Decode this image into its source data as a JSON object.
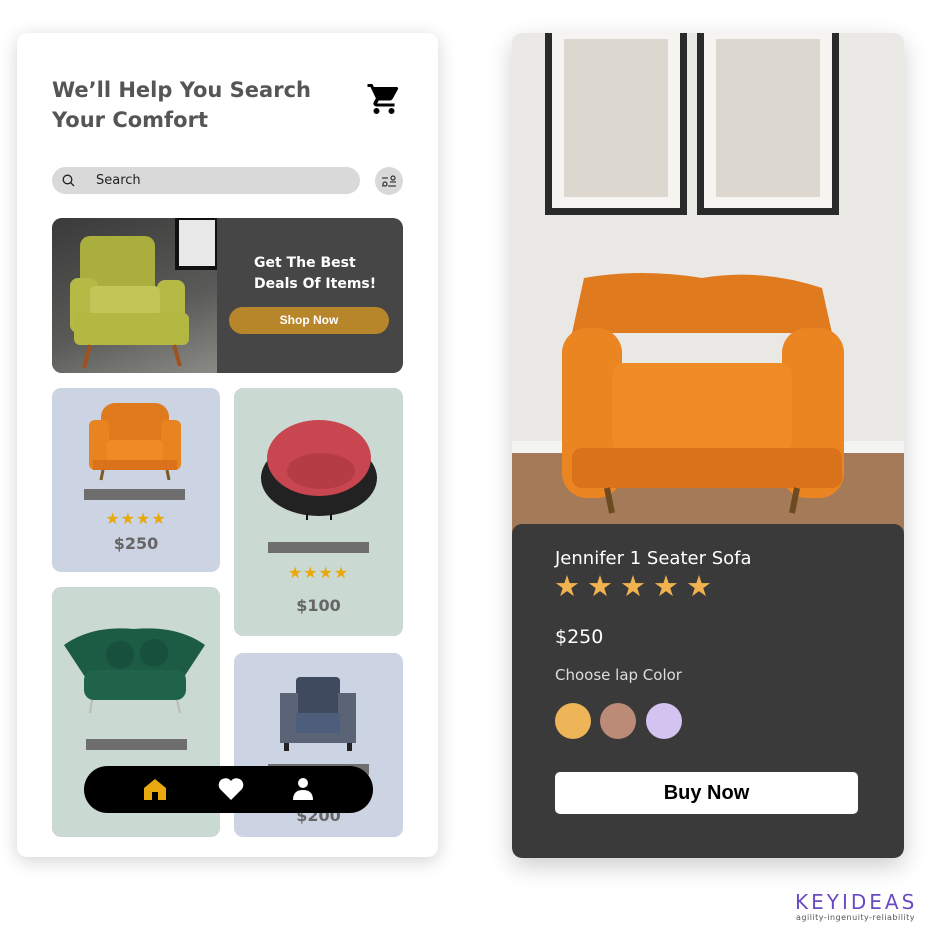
{
  "header": {
    "title": "We’ll Help You Search Your Comfort",
    "cart_icon": "cart-icon"
  },
  "search": {
    "placeholder": "Search",
    "icon": "search-icon",
    "filter_icon": "filter-icon"
  },
  "banner": {
    "headline_line1": "Get The Best",
    "headline_line2": "Deals Of Items!",
    "button": "Shop Now",
    "button_color": "#b8862a"
  },
  "products": [
    {
      "stars": "★★★★",
      "rating": 4,
      "price": "$250",
      "bg": "#ccd3e3"
    },
    {
      "stars": "★★★★",
      "rating": 4,
      "price": "$100",
      "bg": "#cad9d1"
    },
    {
      "bg": "#cad9d1"
    },
    {
      "price": "$200",
      "bg": "#ccd3e3"
    }
  ],
  "nav": {
    "items": [
      "home-icon",
      "heart-icon",
      "user-icon"
    ],
    "active_color": "#e8a80e"
  },
  "detail": {
    "name": "Jennifer 1 Seater Sofa",
    "stars": "★★★★★",
    "rating": 5,
    "price": "$250",
    "choose_label": "Choose lap Color",
    "colors": [
      "#edb458",
      "#bb8b77",
      "#d4c2f0"
    ],
    "buy_button": "Buy Now"
  },
  "brand": {
    "logo": "KEYIDEAS",
    "tagline": "agility-ingenuity-reliability"
  }
}
